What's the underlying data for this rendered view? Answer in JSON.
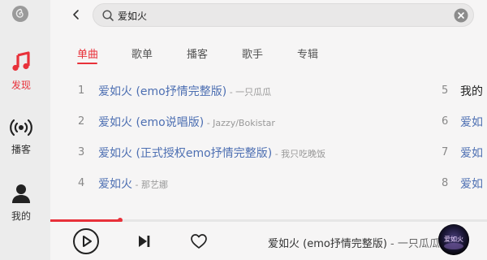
{
  "sidebar": {
    "logo_icon": "netease-cloud-music-logo",
    "items": [
      {
        "label": "发现",
        "icon": "music-note-icon",
        "active": true
      },
      {
        "label": "播客",
        "icon": "broadcast-icon",
        "active": false
      },
      {
        "label": "我的",
        "icon": "person-icon",
        "active": false
      }
    ]
  },
  "header": {
    "back_icon": "chevron-left-icon",
    "search": {
      "value": "爱如火",
      "icon": "search-icon",
      "clear_icon": "clear-icon"
    }
  },
  "tabs": [
    {
      "label": "单曲",
      "active": true
    },
    {
      "label": "歌单",
      "active": false
    },
    {
      "label": "播客",
      "active": false
    },
    {
      "label": "歌手",
      "active": false
    },
    {
      "label": "专辑",
      "active": false
    }
  ],
  "results_left": [
    {
      "num": "1",
      "title": "爱如火 (emo抒情完整版)",
      "artist": "一只瓜瓜"
    },
    {
      "num": "2",
      "title": "爱如火 (emo说唱版)",
      "artist": "Jazzy/Bokistar"
    },
    {
      "num": "3",
      "title": "爱如火 (正式授权emo抒情完整版)",
      "artist": "我只吃晚饭"
    },
    {
      "num": "4",
      "title": "爱如火",
      "artist": "那艺娜"
    }
  ],
  "results_right": [
    {
      "num": "5",
      "title": "我的"
    },
    {
      "num": "6",
      "title": "爱如"
    },
    {
      "num": "7",
      "title": "爱如"
    },
    {
      "num": "8",
      "title": "爱如"
    }
  ],
  "separator": " - ",
  "player": {
    "progress": 0.16,
    "title": "爱如火 (emo抒情完整版)",
    "separator": " - ",
    "artist": "一只瓜瓜",
    "album_art_text": "爱如火",
    "colors": {
      "accent": "#e8313a",
      "link": "#4d6fb2"
    }
  }
}
